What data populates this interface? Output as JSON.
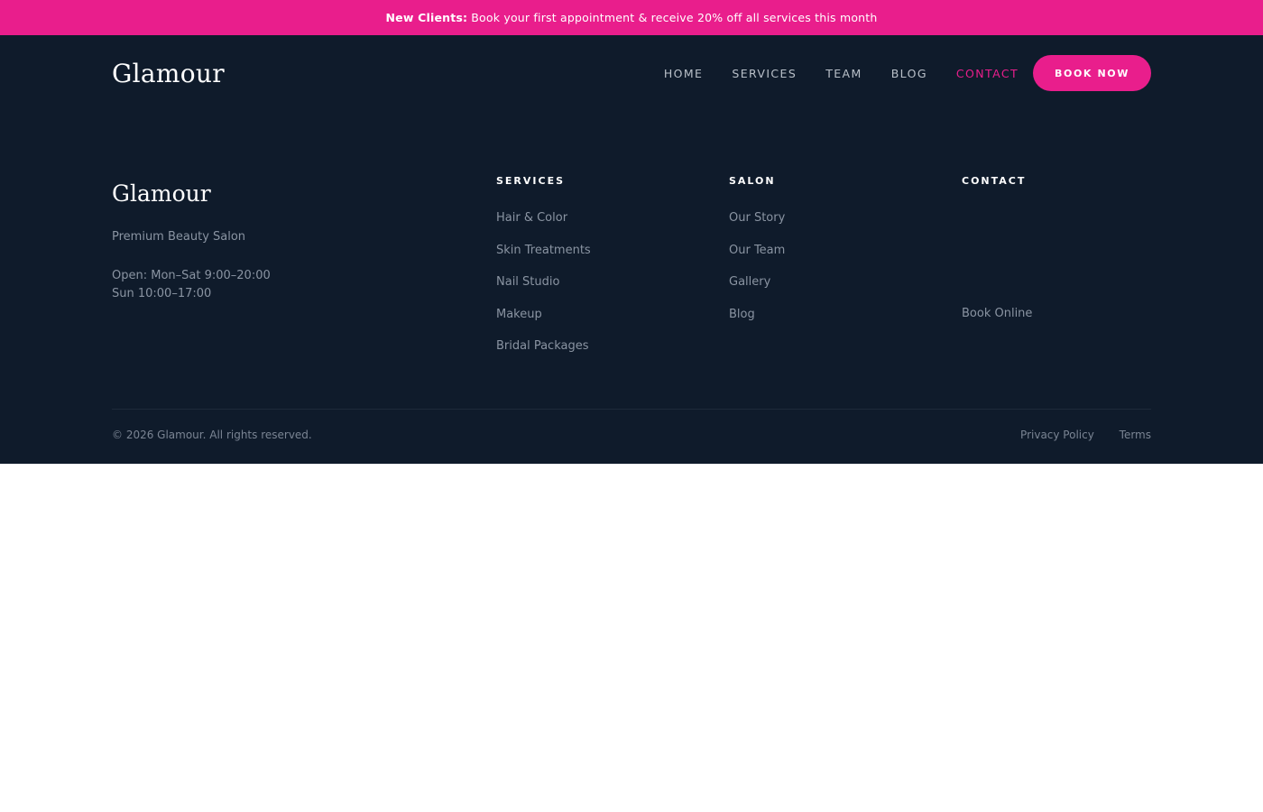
{
  "promo": {
    "bold": "New Clients:",
    "text": "Book your first appointment & receive 20% off all services this month"
  },
  "header": {
    "logo": "Glamour",
    "nav": [
      {
        "label": "HOME"
      },
      {
        "label": "SERVICES"
      },
      {
        "label": "TEAM"
      },
      {
        "label": "BLOG"
      },
      {
        "label": "CONTACT",
        "active": true
      }
    ],
    "cta": "BOOK NOW"
  },
  "footer": {
    "brand": {
      "logo": "Glamour",
      "tagline": "Premium Beauty Salon",
      "hours_line1": "Open: Mon–Sat 9:00–20:00",
      "hours_line2": "Sun 10:00–17:00"
    },
    "columns": {
      "services": {
        "title": "SERVICES",
        "items": [
          "Hair & Color",
          "Skin Treatments",
          "Nail Studio",
          "Makeup",
          "Bridal Packages"
        ]
      },
      "salon": {
        "title": "SALON",
        "items": [
          "Our Story",
          "Our Team",
          "Gallery",
          "Blog"
        ]
      },
      "contact": {
        "title": "CONTACT",
        "items": [
          "Book Online"
        ]
      }
    },
    "copyright": "© 2026 Glamour. All rights reserved.",
    "legal": [
      "Privacy Policy",
      "Terms"
    ]
  },
  "colors": {
    "accent": "#e91e8c",
    "background_dark": "#0f1b2b",
    "muted_text": "#8a94a2"
  }
}
